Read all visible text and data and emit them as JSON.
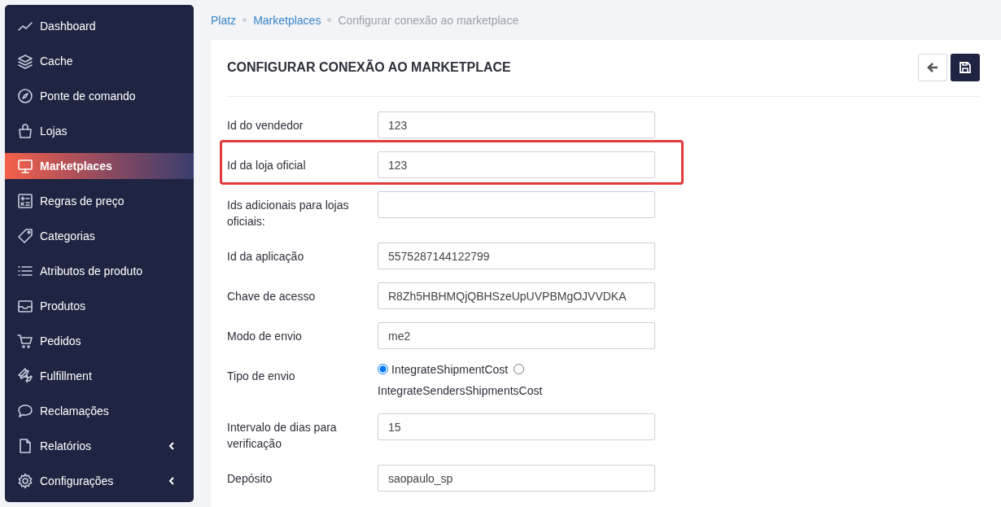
{
  "sidebar": {
    "items": [
      {
        "label": "Dashboard",
        "selected": false,
        "submenu": false
      },
      {
        "label": "Cache",
        "selected": false,
        "submenu": false
      },
      {
        "label": "Ponte de comando",
        "selected": false,
        "submenu": false
      },
      {
        "label": "Lojas",
        "selected": false,
        "submenu": false
      },
      {
        "label": "Marketplaces",
        "selected": true,
        "submenu": false
      },
      {
        "label": "Regras de preço",
        "selected": false,
        "submenu": false
      },
      {
        "label": "Categorias",
        "selected": false,
        "submenu": false
      },
      {
        "label": "Atributos de produto",
        "selected": false,
        "submenu": false
      },
      {
        "label": "Produtos",
        "selected": false,
        "submenu": false
      },
      {
        "label": "Pedidos",
        "selected": false,
        "submenu": false
      },
      {
        "label": "Fulfillment",
        "selected": false,
        "submenu": false
      },
      {
        "label": "Reclamações",
        "selected": false,
        "submenu": false
      },
      {
        "label": "Relatórios",
        "selected": false,
        "submenu": true
      },
      {
        "label": "Configurações",
        "selected": false,
        "submenu": true
      }
    ]
  },
  "breadcrumb": [
    {
      "label": "Platz",
      "kind": "link"
    },
    {
      "label": "Marketplaces",
      "kind": "link"
    },
    {
      "label": "Configurar conexão ao marketplace",
      "kind": "current"
    }
  ],
  "card": {
    "title": "CONFIGURAR CONEXÃO AO MARKETPLACE",
    "fields": [
      {
        "kind": "text",
        "label": "Id do vendedor",
        "value": "123",
        "highlighted": false
      },
      {
        "kind": "text",
        "label": "Id da loja oficial",
        "value": "123",
        "highlighted": true
      },
      {
        "kind": "text",
        "label": "Ids adicionais para lojas oficiais:",
        "highlighted": false
      },
      {
        "kind": "text",
        "label": "Id da aplicação",
        "value": "5575287144122799",
        "highlighted": false
      },
      {
        "kind": "text",
        "label": "Chave de acesso",
        "value": "R8Zh5HBHMQjQBHSzeUpUVPBMgOJVVDKA",
        "highlighted": false
      },
      {
        "kind": "text",
        "label": "Modo de envio",
        "value": "me2",
        "highlighted": false
      },
      {
        "kind": "radio",
        "label": "Tipo de envio",
        "highlighted": false,
        "options": [
          {
            "label": "IntegrateShipmentCost",
            "selected": true
          },
          {
            "label": "IntegrateSendersShipmentsCost",
            "selected": false
          }
        ]
      },
      {
        "kind": "text",
        "label": "Intervalo de dias para verificação",
        "value": "15",
        "highlighted": false
      },
      {
        "kind": "text",
        "label": "Depósito",
        "value": "saopaulo_sp",
        "highlighted": false
      }
    ]
  }
}
